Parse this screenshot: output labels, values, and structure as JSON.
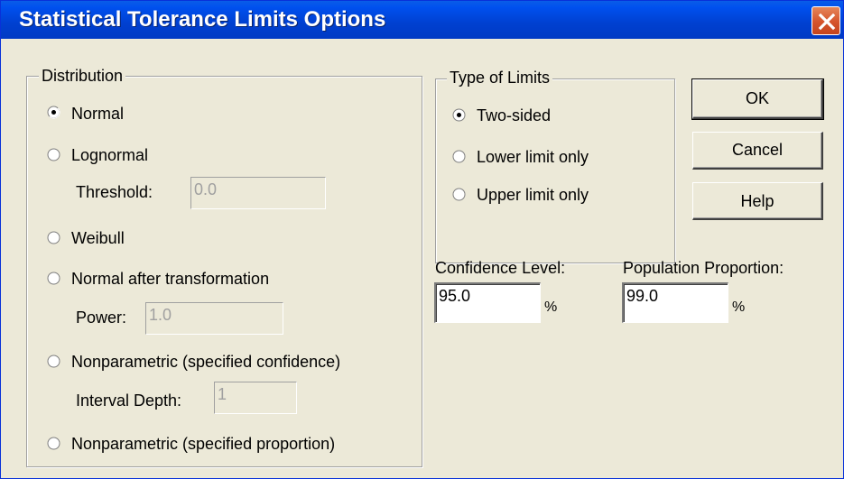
{
  "window": {
    "title": "Statistical Tolerance Limits Options"
  },
  "distribution": {
    "legend": "Distribution",
    "options": [
      {
        "label": "Normal",
        "selected": true
      },
      {
        "label": "Lognormal",
        "selected": false
      },
      {
        "label": "Weibull",
        "selected": false
      },
      {
        "label": "Normal after transformation",
        "selected": false
      },
      {
        "label": "Nonparametric (specified confidence)",
        "selected": false
      },
      {
        "label": "Nonparametric (specified proportion)",
        "selected": false
      }
    ],
    "threshold": {
      "label": "Threshold:",
      "value": "0.0"
    },
    "power": {
      "label": "Power:",
      "value": "1.0"
    },
    "interval_depth": {
      "label": "Interval Depth:",
      "value": "1"
    }
  },
  "limits": {
    "legend": "Type of Limits",
    "options": [
      {
        "label": "Two-sided",
        "selected": true
      },
      {
        "label": "Lower limit only",
        "selected": false
      },
      {
        "label": "Upper limit only",
        "selected": false
      }
    ]
  },
  "confidence": {
    "label": "Confidence Level:",
    "value": "95.0",
    "unit": "%"
  },
  "proportion": {
    "label": "Population Proportion:",
    "value": "99.0",
    "unit": "%"
  },
  "buttons": {
    "ok": "OK",
    "cancel": "Cancel",
    "help": "Help"
  }
}
